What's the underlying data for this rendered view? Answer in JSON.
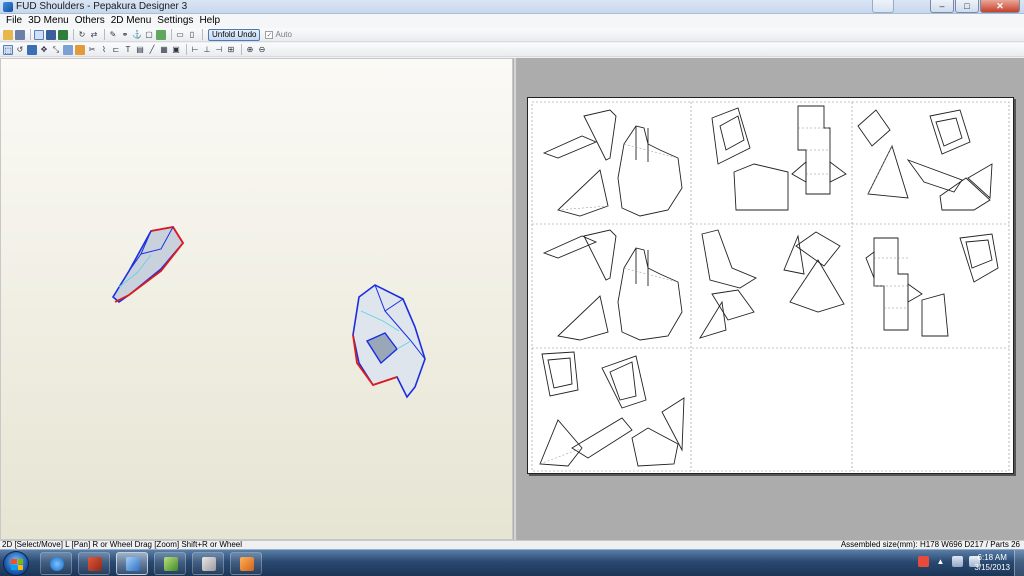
{
  "window": {
    "title": "FUD Shoulders - Pepakura Designer 3"
  },
  "menu": [
    "File",
    "3D Menu",
    "Others",
    "2D Menu",
    "Settings",
    "Help"
  ],
  "toolbar": {
    "unfold_undo_label": "Unfold Undo",
    "auto_label": "Auto",
    "auto_checked": true
  },
  "statusbar": {
    "hint": "2D [Select/Move] L [Pan] R or Wheel Drag [Zoom] Shift+R or Wheel",
    "info": "Assembled size(mm): H178 W696 D217 / Parts 26"
  },
  "taskbar": {
    "apps": [
      "start-button",
      "internet-explorer-icon",
      "pepakura-viewer-icon",
      "pepakura-designer-icon",
      "notepad-icon",
      "media-player-icon",
      "paint-icon"
    ],
    "time": "6:18 AM",
    "date": "3/15/2013"
  },
  "colors": {
    "model_edge_blue": "#1a2ee0",
    "model_edge_red": "#e01a1a",
    "model_fill": "#c9d1dc"
  }
}
